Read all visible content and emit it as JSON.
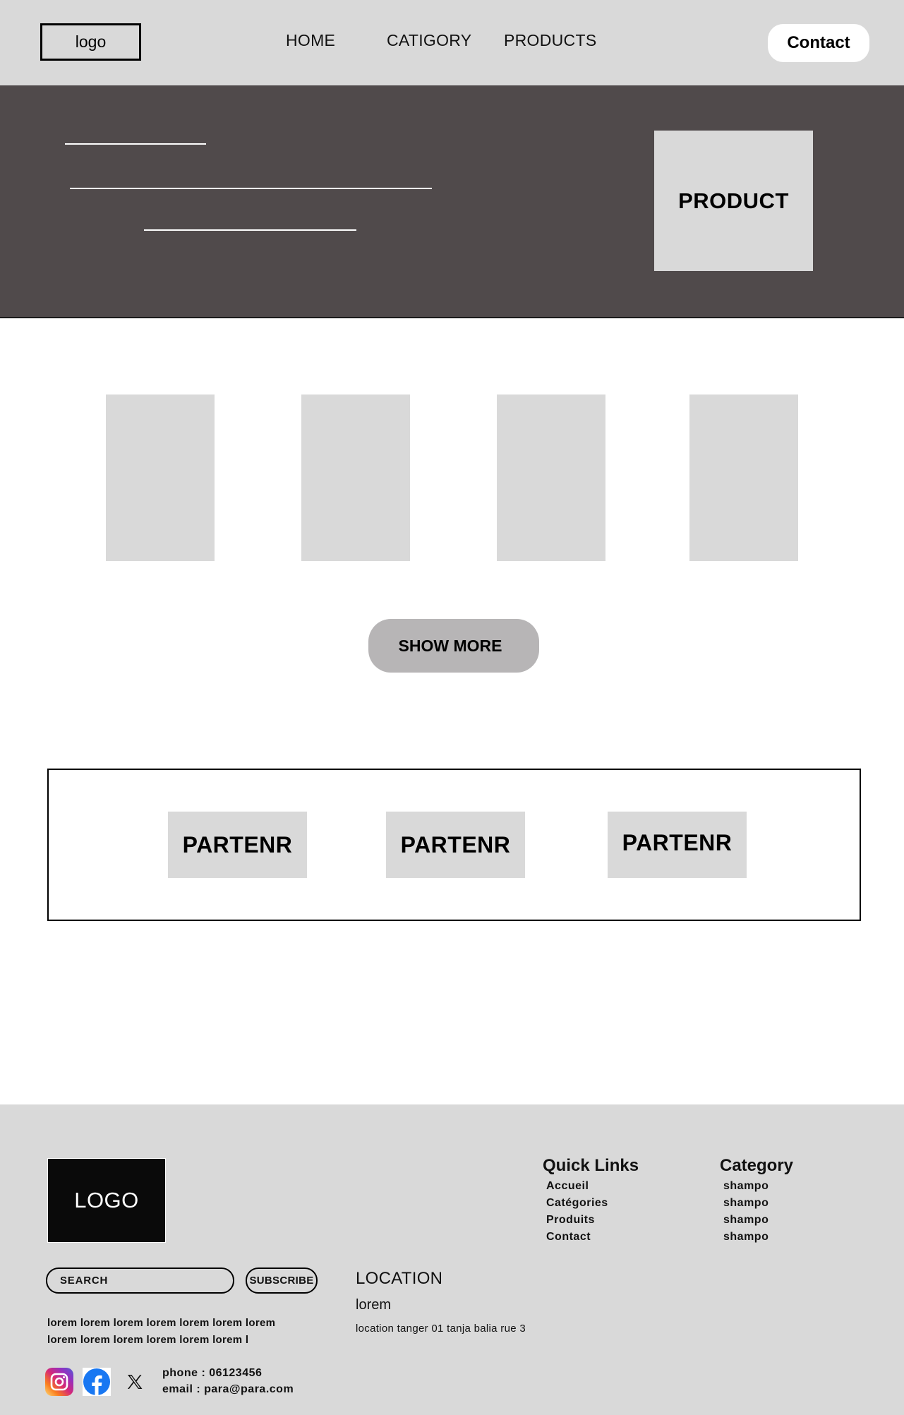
{
  "header": {
    "logo": "logo",
    "nav": [
      "HOME",
      "CATIGORY",
      "PRODUCTS"
    ],
    "contact_button": "Contact"
  },
  "hero": {
    "product_label": "PRODUCT"
  },
  "products": {
    "card_count": 4,
    "show_more": "SHOW MORE"
  },
  "partners": [
    "PARTENR",
    "PARTENR",
    "PARTENR"
  ],
  "footer": {
    "logo": "LOGO",
    "quick_links": {
      "title": "Quick Links",
      "items": [
        "Accueil",
        "Catégories",
        "Produits",
        "Contact"
      ]
    },
    "category": {
      "title": "Category",
      "items": [
        "shampo",
        "shampo",
        "shampo",
        "shampo"
      ]
    },
    "search_placeholder": "SEARCH",
    "subscribe_button": "SUBSCRIBE",
    "location": {
      "title": "LOCATION",
      "subtitle": "lorem",
      "address": "location tanger 01 tanja balia rue 3"
    },
    "lorem_lines": [
      "lorem lorem lorem lorem  lorem lorem lorem",
      "lorem lorem lorem lorem lorem lorem l"
    ],
    "phone": "phone : 06123456",
    "email": "email : para@para.com",
    "social_icons": [
      "instagram-icon",
      "facebook-icon",
      "x-icon"
    ]
  },
  "colors": {
    "header_bg": "#d9d9d9",
    "hero_bg": "#504a4b",
    "placeholder_gray": "#d9d9d9",
    "show_more_bg": "#b7b5b6",
    "footer_logo_bg": "#0a0a0a"
  }
}
